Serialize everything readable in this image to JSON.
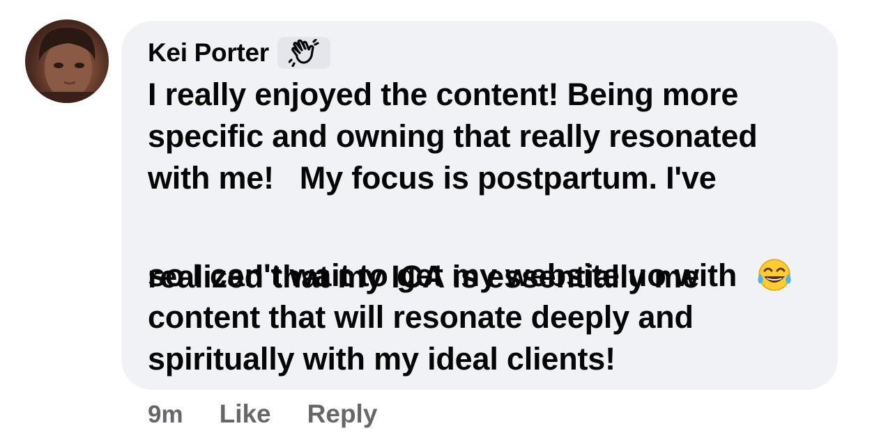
{
  "comment": {
    "author": "Kei Porter",
    "badge_icon": "waving-hand-icon",
    "lines": [
      "I really enjoyed the content! Being more",
      "specific and owning that really resonated",
      "with me!   My focus is postpartum. I've",
      "realized that my ICA is essentially me",
      "so I can't wait to get my website uo with",
      "content that will resonate deeply and",
      "spiritually with my ideal clients!"
    ],
    "emoji": "face-with-tears-of-joy-icon"
  },
  "actions": {
    "time": "9m",
    "like_label": "Like",
    "reply_label": "Reply"
  },
  "colors": {
    "bubble_bg": "#f0f2f5",
    "text": "#050505",
    "secondary_text": "#65676b"
  }
}
